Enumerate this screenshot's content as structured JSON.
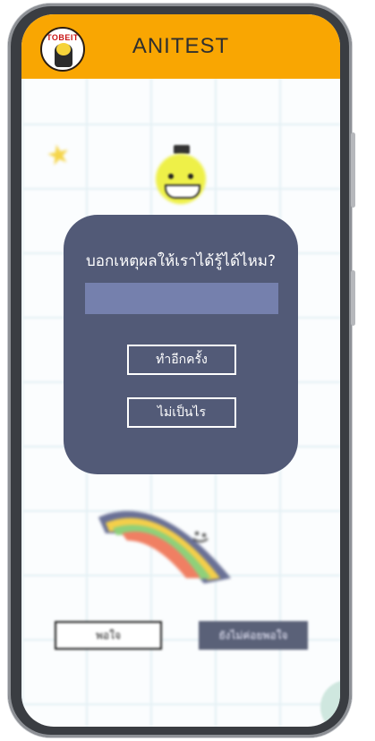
{
  "app": {
    "title": "ANITEST",
    "logo_text": "TOBEIT"
  },
  "dialog": {
    "question": "บอกเหตุผลให้เราได้รู้ได้ไหม?",
    "input_value": "",
    "input_placeholder": "",
    "retry_label": "ทำอีกครั้ง",
    "ok_label": "ไม่เป็นไร"
  },
  "background": {
    "left_button_label": "พอใจ",
    "right_button_label": "ยังไม่ค่อยพอใจ"
  },
  "colors": {
    "header": "#f9a602",
    "dialog": "#525a77",
    "input": "#7580ad",
    "rainbow": [
      "#6a7196",
      "#f4cf4a",
      "#8fd07a",
      "#f07f63"
    ]
  }
}
